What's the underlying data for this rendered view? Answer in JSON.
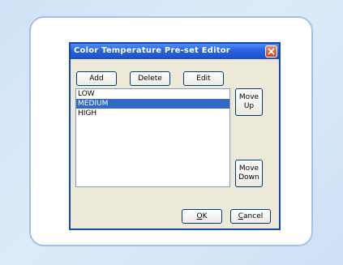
{
  "dialog": {
    "title": "Color Temperature Pre-set Editor",
    "buttons": {
      "add": "Add",
      "delete": "Delete",
      "edit": "Edit",
      "move_up_line1": "Move",
      "move_up_line2": "Up",
      "move_down_line1": "Move",
      "move_down_line2": "Down",
      "ok_mnemonic": "O",
      "ok_rest": "K",
      "cancel_mnemonic": "C",
      "cancel_rest": "ancel"
    },
    "list": {
      "items": [
        "LOW",
        "MEDIUM",
        "HIGH"
      ],
      "selected": "MEDIUM"
    }
  },
  "colors": {
    "titlebar": "#2a64e0",
    "selection": "#316ac5",
    "close": "#d0461f",
    "frame_border": "#9ec3e6"
  },
  "icons": {
    "close": "close-icon"
  }
}
